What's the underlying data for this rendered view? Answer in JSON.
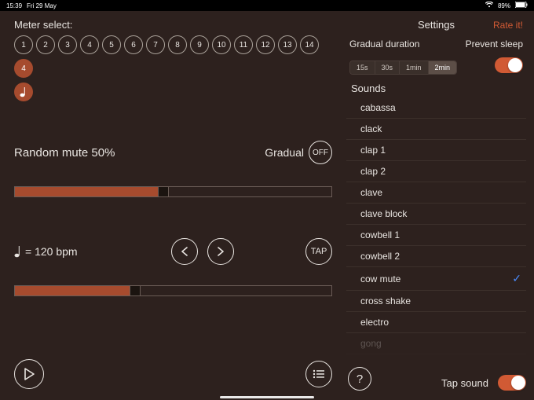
{
  "statusbar": {
    "time": "15:39",
    "date": "Fri 29 May",
    "battery": "89%"
  },
  "left": {
    "meter_select_label": "Meter select:",
    "meters_row1": [
      "1",
      "2",
      "3",
      "4",
      "5",
      "6",
      "7",
      "8",
      "9",
      "10",
      "11",
      "12",
      "13",
      "14"
    ],
    "selected_meter": "4",
    "random_mute_label": "Random mute 50%",
    "gradual_label": "Gradual",
    "gradual_off": "OFF",
    "slider1_percent": 47,
    "tempo_text": "= 120 bpm",
    "tap_label": "TAP",
    "slider2_percent": 38
  },
  "right": {
    "settings_title": "Settings",
    "rate_label": "Rate it!",
    "gradual_duration_label": "Gradual duration",
    "prevent_sleep_label": "Prevent sleep",
    "seg_options": [
      "15s",
      "30s",
      "1min",
      "2min"
    ],
    "seg_selected_index": 3,
    "sounds_label": "Sounds",
    "sounds": [
      "cabassa",
      "clack",
      "clap 1",
      "clap 2",
      "clave",
      "clave block",
      "cowbell 1",
      "cowbell 2",
      "cow mute",
      "cross shake",
      "electro",
      "gong"
    ],
    "selected_sound_index": 8,
    "tap_sound_label": "Tap sound"
  }
}
